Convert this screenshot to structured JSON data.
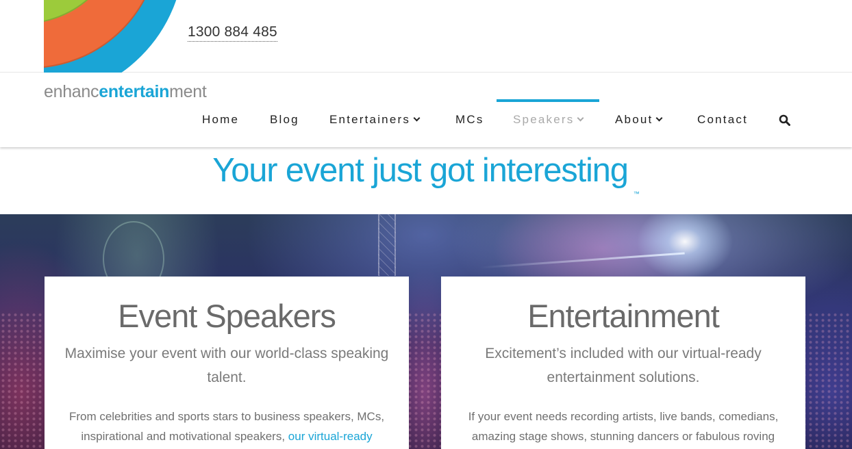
{
  "colors": {
    "accent": "#1aa5d6",
    "logo_orange": "#ef6b3a",
    "logo_green": "#9ccb3b",
    "logo_blue": "#1aa5d6"
  },
  "header": {
    "phone": "1300 884 485",
    "brand": {
      "part1": "enhanc",
      "part2": "entertain",
      "part3": "ment"
    }
  },
  "nav": {
    "items": [
      {
        "label": "Home",
        "dropdown": false
      },
      {
        "label": "Blog",
        "dropdown": false
      },
      {
        "label": "Entertainers",
        "dropdown": true
      },
      {
        "label": "MCs",
        "dropdown": false
      },
      {
        "label": "Speakers",
        "dropdown": true,
        "active": true
      },
      {
        "label": "About",
        "dropdown": true
      },
      {
        "label": "Contact",
        "dropdown": false
      }
    ],
    "search_icon": "search-icon"
  },
  "tagline": {
    "text": "Your event just got interesting",
    "mark": "™"
  },
  "cards": [
    {
      "title": "Event Speakers",
      "subtitle": "Maximise your event with our world-class speaking talent.",
      "body": "From celebrities and sports stars to business speakers, MCs, inspirational and motivational speakers, ",
      "link": "our virtual-ready"
    },
    {
      "title": "Entertainment",
      "subtitle": "Excitement’s included with our virtual-ready entertainment solutions.",
      "body": "If your event needs recording artists, live bands, comedians, amazing stage shows, stunning dancers or fabulous roving"
    }
  ]
}
